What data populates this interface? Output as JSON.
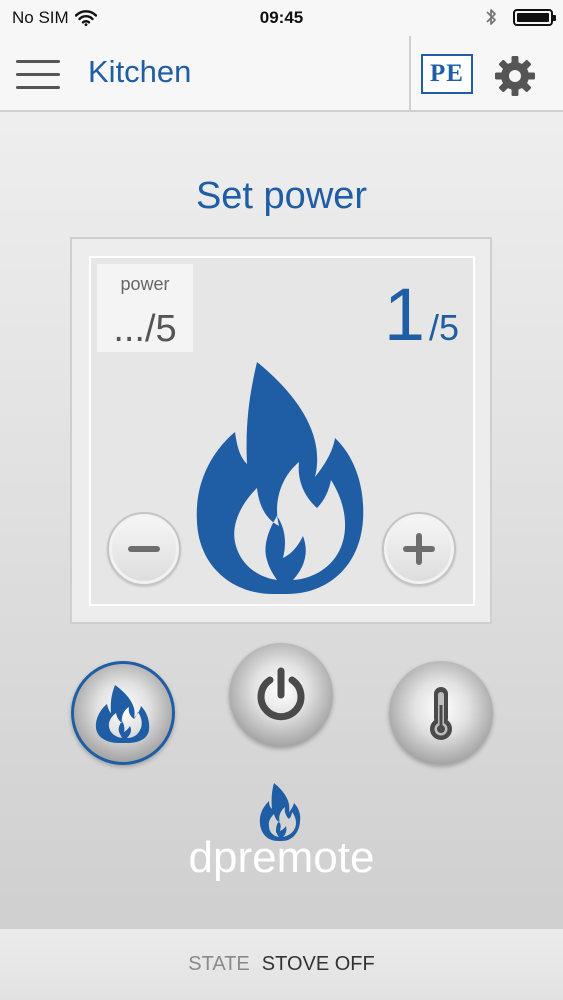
{
  "status_bar": {
    "carrier": "No SIM",
    "time": "09:45",
    "wifi_icon": "wifi-icon",
    "bluetooth_icon": "bluetooth-icon",
    "battery_icon": "battery-icon"
  },
  "nav": {
    "title": "Kitchen",
    "menu_icon": "hamburger-menu-icon",
    "logo_text": "PE",
    "settings_icon": "gear-icon"
  },
  "main": {
    "title": "Set power",
    "power_box": {
      "label": "power",
      "value": ".../5"
    },
    "current_power": {
      "value": "1",
      "max": "/5"
    },
    "level": {
      "current": 1,
      "max": 5
    }
  },
  "controls": [
    {
      "name": "flame-mode",
      "icon": "flame-icon",
      "active": true
    },
    {
      "name": "power-toggle",
      "icon": "power-icon",
      "active": false
    },
    {
      "name": "temperature-mode",
      "icon": "thermometer-icon",
      "active": false
    }
  ],
  "brand": {
    "text_dp": "dp",
    "text_remote": "remote"
  },
  "footer": {
    "state_label": "STATE",
    "state_value": "STOVE OFF"
  },
  "colors": {
    "accent": "#1f5da4",
    "background": "#e4e4e4",
    "brand_white": "#ffffff"
  }
}
